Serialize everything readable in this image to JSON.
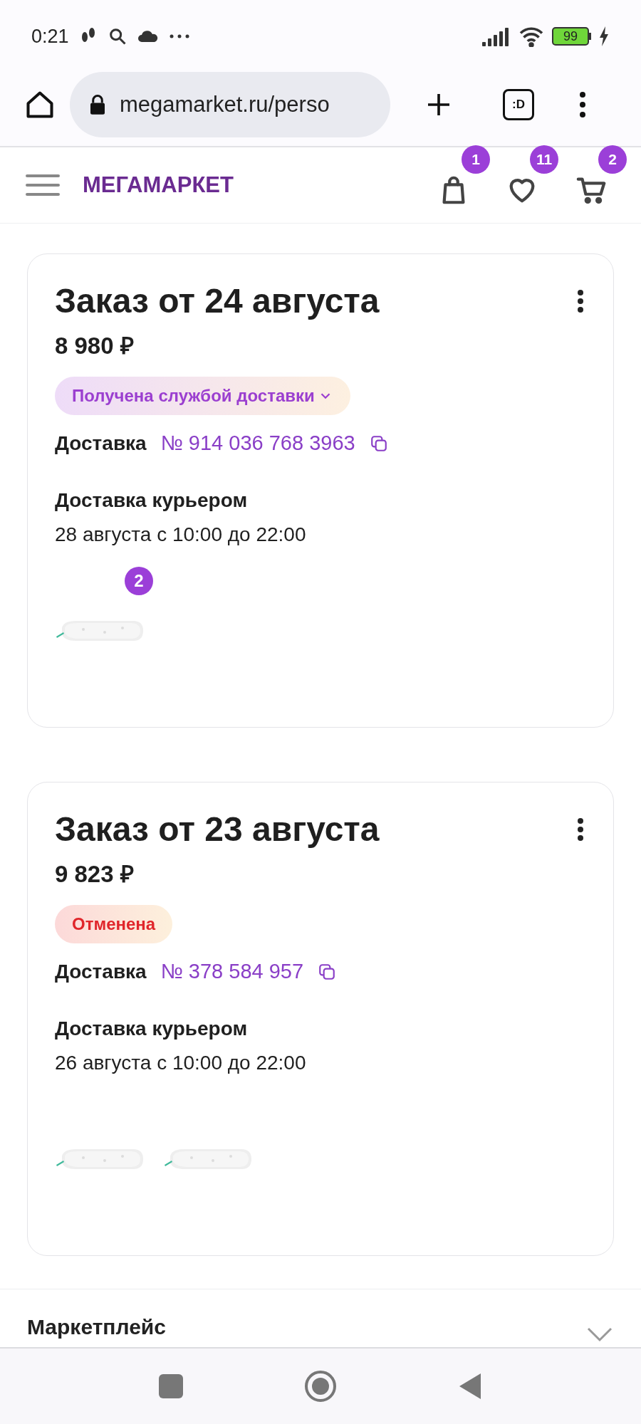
{
  "status_bar": {
    "time": "0:21",
    "battery": "99"
  },
  "browser": {
    "url": "megamarket.ru/perso",
    "tabs_label": ":D"
  },
  "header": {
    "logo": "МЕГАМАРКЕТ",
    "badges": [
      {
        "kind": "bag",
        "count": "1"
      },
      {
        "kind": "heart",
        "count": "11"
      },
      {
        "kind": "cart",
        "count": "2"
      }
    ]
  },
  "orders": [
    {
      "title": "Заказ от 24 августа",
      "price": "8 980 ₽",
      "status": {
        "kind": "received",
        "label": "Получена службой доставки",
        "expandable": true
      },
      "delivery_label": "Доставка",
      "delivery_number": "№ 914 036 768 3963",
      "method": "Доставка курьером",
      "time": "28 августа с 10:00 до 22:00",
      "items": [
        {
          "kind": "picture",
          "count": "2"
        }
      ]
    },
    {
      "title": "Заказ от 23 августа",
      "price": "9 823 ₽",
      "status": {
        "kind": "cancelled",
        "label": "Отменена",
        "expandable": false
      },
      "delivery_label": "Доставка",
      "delivery_number": "№ 378 584 957",
      "method": "Доставка курьером",
      "time": "26 августа с 10:00 до 22:00"
    }
  ],
  "section": {
    "title": "Маркетплейс",
    "expanded": false
  }
}
